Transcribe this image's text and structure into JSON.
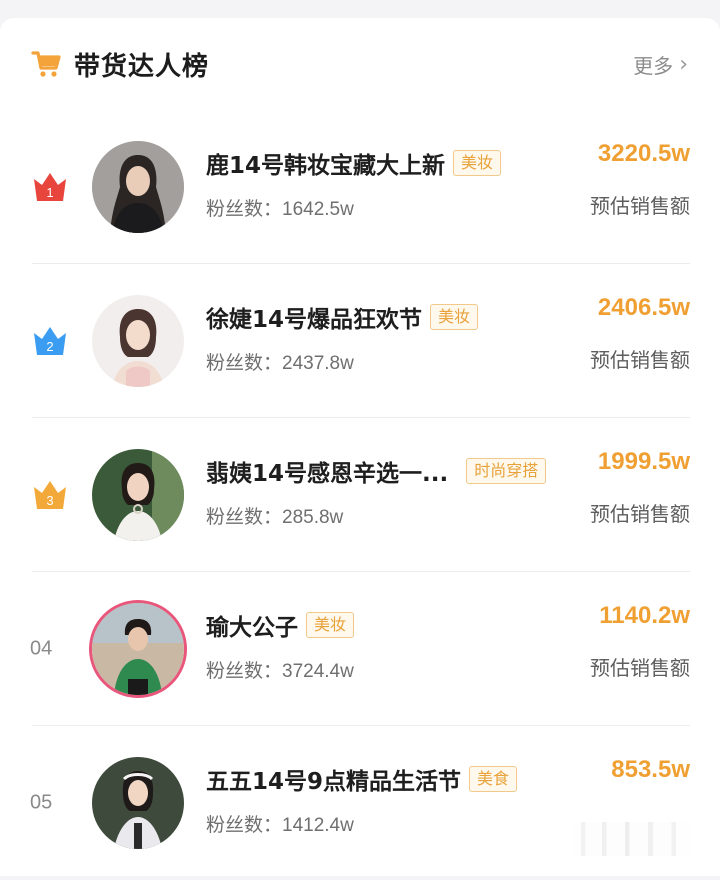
{
  "header": {
    "title": "带货达人榜",
    "more_label": "更多"
  },
  "colors": {
    "accent": "#f0a033",
    "tag": "#e8a23b",
    "rank1": "#e8453c",
    "rank2": "#3a9df2",
    "rank3": "#f3a93a"
  },
  "list": [
    {
      "rank": "1",
      "name": "鹿14号韩妆宝藏大上新",
      "tag": "美妆",
      "fans_label": "粉丝数：",
      "fans": "1642.5w",
      "amount": "3220.5w",
      "amount_label": "预估销售额"
    },
    {
      "rank": "2",
      "name": "徐婕14号爆品狂欢节",
      "tag": "美妆",
      "fans_label": "粉丝数：",
      "fans": "2437.8w",
      "amount": "2406.5w",
      "amount_label": "预估销售额"
    },
    {
      "rank": "3",
      "name": "翡姨14号感恩辛选一...",
      "tag": "时尚穿搭",
      "fans_label": "粉丝数：",
      "fans": "285.8w",
      "amount": "1999.5w",
      "amount_label": "预估销售额"
    },
    {
      "rank": "04",
      "name": "瑜大公子",
      "tag": "美妆",
      "fans_label": "粉丝数：",
      "fans": "3724.4w",
      "amount": "1140.2w",
      "amount_label": "预估销售额"
    },
    {
      "rank": "05",
      "name": "五五14号9点精品生活节",
      "tag": "美食",
      "fans_label": "粉丝数：",
      "fans": "1412.4w",
      "amount": "853.5w",
      "amount_label": ""
    }
  ]
}
